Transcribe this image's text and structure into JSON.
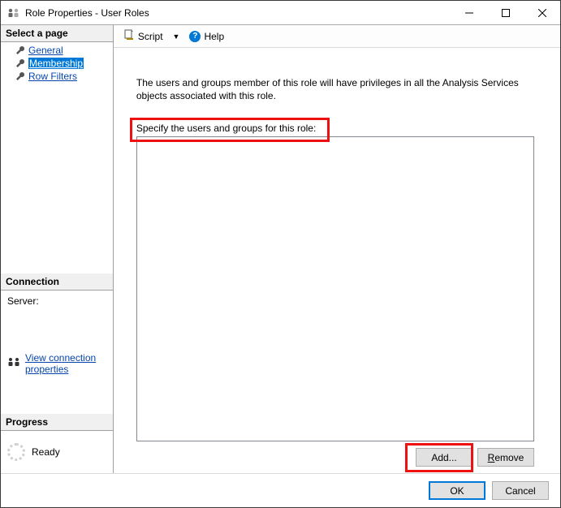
{
  "titlebar": {
    "title": "Role Properties - User Roles"
  },
  "sidebar": {
    "select_page_header": "Select a page",
    "pages": [
      {
        "label": "General",
        "selected": false
      },
      {
        "label": "Membership",
        "selected": true
      },
      {
        "label": "Row Filters",
        "selected": false
      }
    ],
    "connection_header": "Connection",
    "server_label": "Server:",
    "view_conn_props": "View connection properties",
    "progress_header": "Progress",
    "progress_status": "Ready"
  },
  "toolbar": {
    "script_label": "Script",
    "help_label": "Help"
  },
  "main": {
    "description": "The users and groups member of this role will have privileges in all the Analysis Services objects associated with this role.",
    "specify_label": "Specify the users and groups for this role:",
    "add_label": "Add...",
    "remove_label_prefix": "R",
    "remove_label_rest": "emove"
  },
  "footer": {
    "ok_label": "OK",
    "cancel_label": "Cancel"
  }
}
